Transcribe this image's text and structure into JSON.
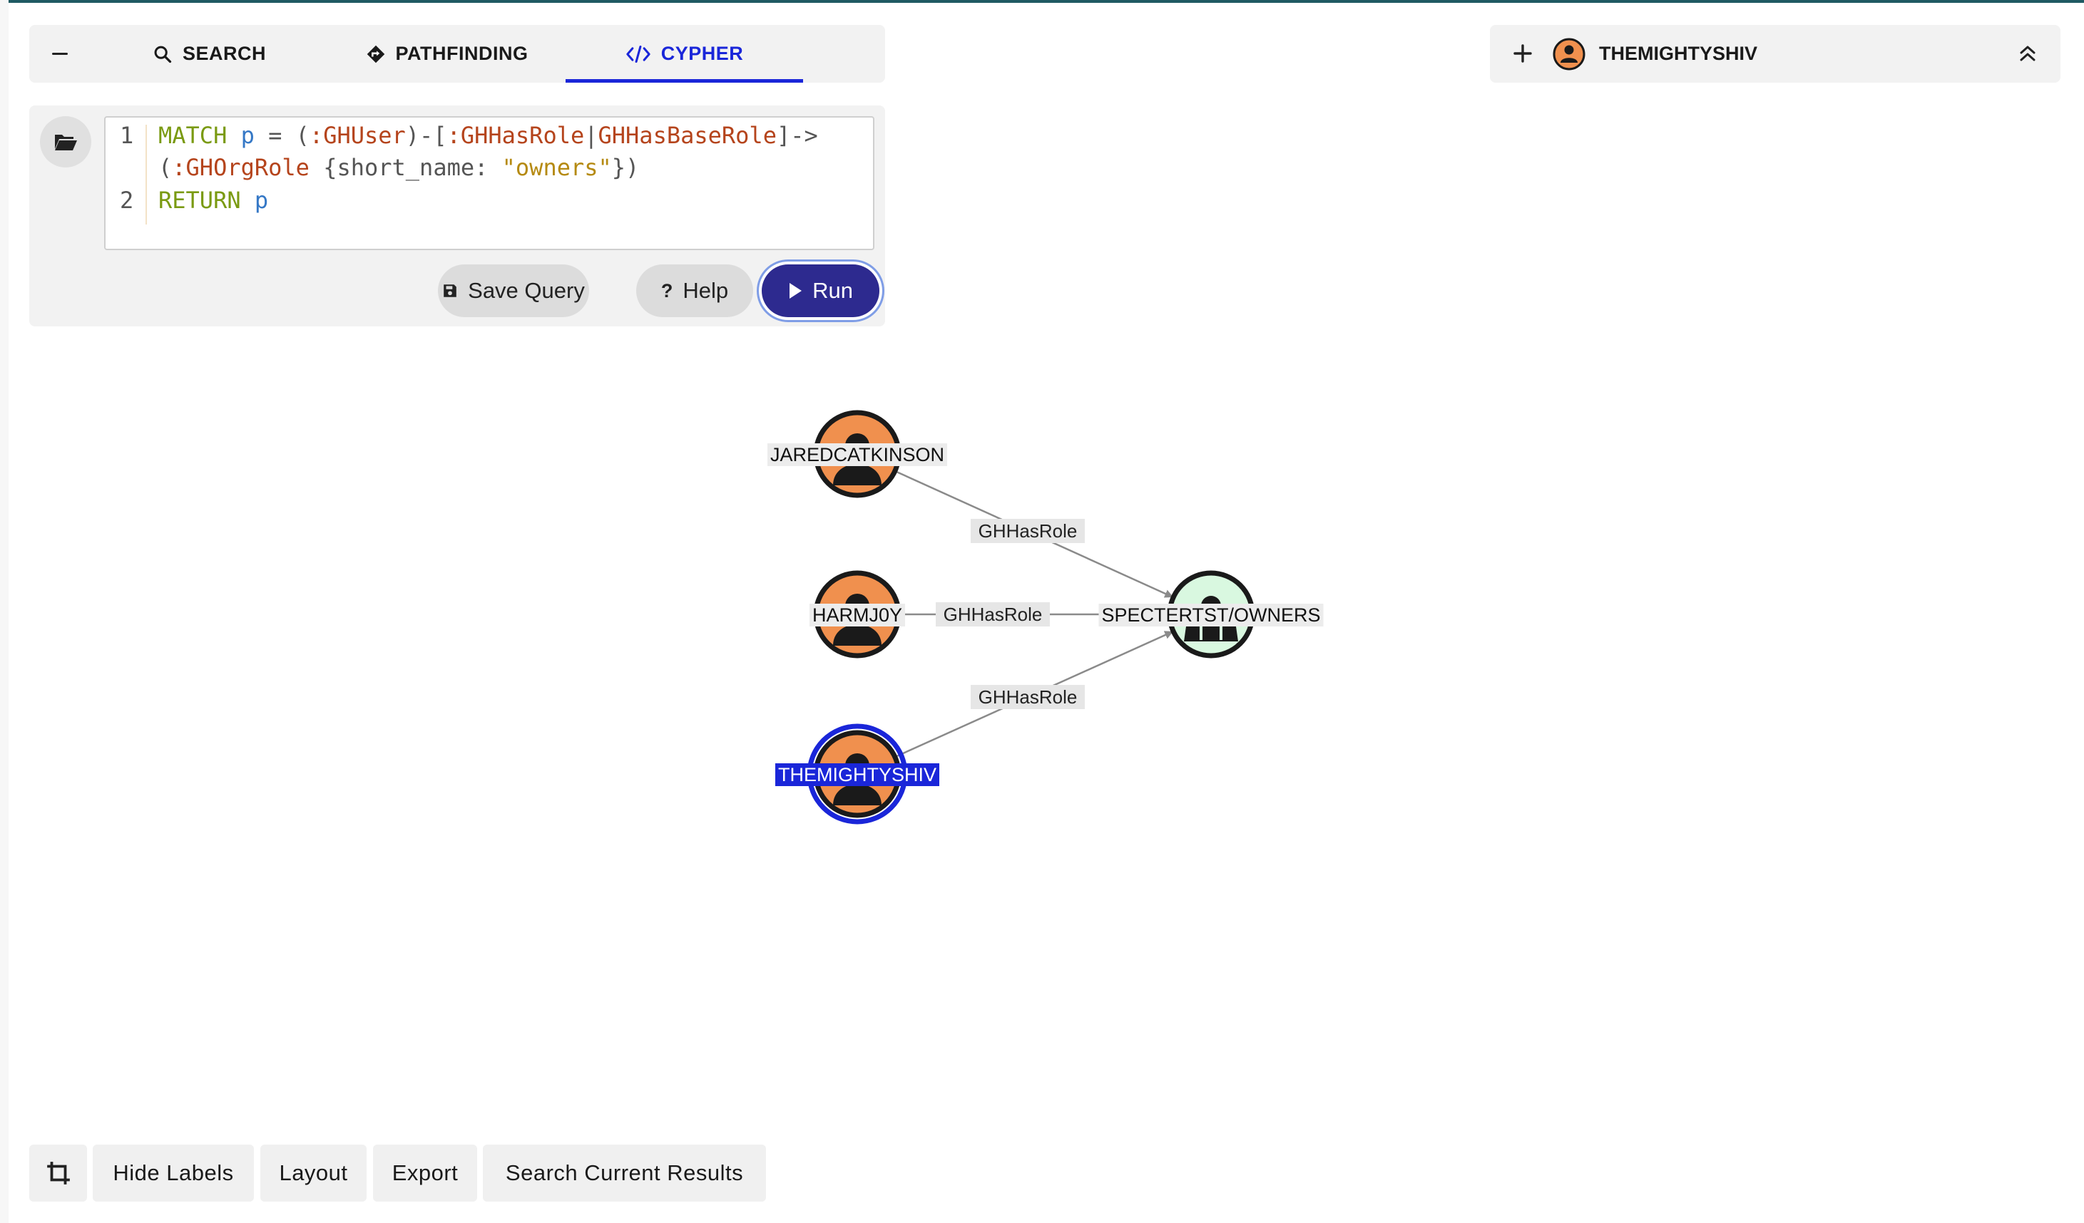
{
  "tabs": {
    "collapse_icon": "minus-icon",
    "items": [
      {
        "label": "SEARCH",
        "icon": "search-icon"
      },
      {
        "label": "PATHFINDING",
        "icon": "route-diamond-icon"
      },
      {
        "label": "CYPHER",
        "icon": "code-icon",
        "active": true
      }
    ],
    "active_color": "#1a26d9"
  },
  "query": {
    "folder_icon": "folder-open-icon",
    "line_numbers": [
      "1",
      "2"
    ],
    "lines": [
      [
        {
          "text": "MATCH",
          "cls": "kw"
        },
        {
          "text": " "
        },
        {
          "text": "p",
          "cls": "var"
        },
        {
          "text": " = ",
          "cls": "plain"
        },
        {
          "text": "(",
          "cls": "plain"
        },
        {
          "text": ":GHUser",
          "cls": "lbl"
        },
        {
          "text": ")-[",
          "cls": "plain"
        },
        {
          "text": ":GHHasRole",
          "cls": "lbl"
        },
        {
          "text": "|",
          "cls": "plain"
        },
        {
          "text": "GHHasBaseRole",
          "cls": "lbl"
        },
        {
          "text": "]->",
          "cls": "plain"
        }
      ],
      [
        {
          "text": "(",
          "cls": "plain"
        },
        {
          "text": ":GHOrgRole",
          "cls": "lbl"
        },
        {
          "text": " {short_name: ",
          "cls": "plain"
        },
        {
          "text": "\"owners\"",
          "cls": "str"
        },
        {
          "text": "})",
          "cls": "plain"
        }
      ],
      [
        {
          "text": "RETURN",
          "cls": "kw"
        },
        {
          "text": " "
        },
        {
          "text": "p",
          "cls": "var"
        }
      ]
    ],
    "buttons": {
      "save": {
        "label": "Save Query",
        "icon": "save-icon"
      },
      "help": {
        "label": "Help",
        "icon": "question-icon"
      },
      "run": {
        "label": "Run",
        "icon": "play-icon",
        "color": "#2d2a8f"
      }
    }
  },
  "account": {
    "plus_icon": "plus-icon",
    "avatar_icon": "user-avatar-icon",
    "name": "THEMIGHTYSHIV",
    "chevron_icon": "chevrons-up-icon"
  },
  "graph": {
    "nodes": [
      {
        "id": "n1",
        "label": "JAREDCATKINSON",
        "kind": "GHUser",
        "fill": "#f0904e"
      },
      {
        "id": "n2",
        "label": "HARMJ0Y",
        "kind": "GHUser",
        "fill": "#f0904e"
      },
      {
        "id": "n3",
        "label": "THEMIGHTYSHIV",
        "kind": "GHUser",
        "fill": "#f0904e",
        "selected": true
      },
      {
        "id": "n4",
        "label": "SPECTERTST/OWNERS",
        "kind": "GHOrgRole",
        "fill": "#d9f8e0"
      }
    ],
    "edges": [
      {
        "from": "n1",
        "to": "n4",
        "label": "GHHasRole"
      },
      {
        "from": "n2",
        "to": "n4",
        "label": "GHHasRole"
      },
      {
        "from": "n3",
        "to": "n4",
        "label": "GHHasRole"
      }
    ],
    "selected_color": "#1a26d9"
  },
  "toolbar": {
    "crop_icon": "crop-icon",
    "hide_labels": "Hide Labels",
    "layout": "Layout",
    "export": "Export",
    "search_results": "Search Current Results"
  }
}
